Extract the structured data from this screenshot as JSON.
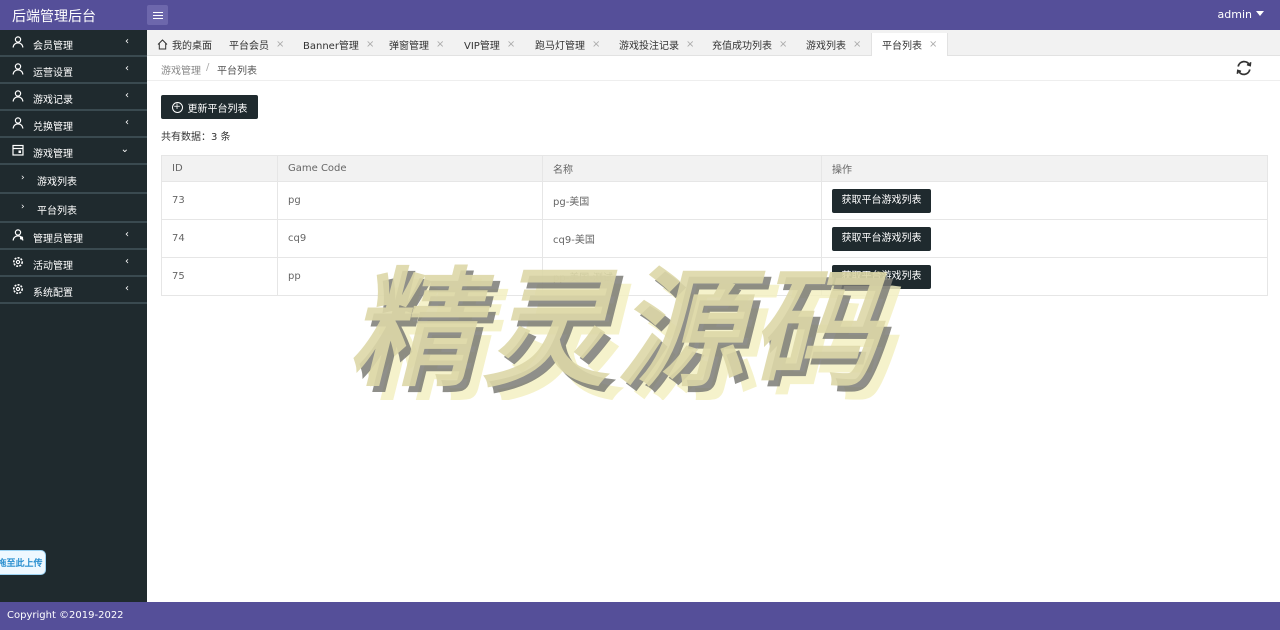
{
  "header": {
    "brand": "后端管理后台",
    "user": "admin"
  },
  "sidebar": {
    "items": [
      {
        "label": "会员管理",
        "icon": "user-icon",
        "arrow": "‹"
      },
      {
        "label": "运营设置",
        "icon": "user-icon",
        "arrow": "‹"
      },
      {
        "label": "游戏记录",
        "icon": "user-icon",
        "arrow": "‹"
      },
      {
        "label": "兑换管理",
        "icon": "user-icon",
        "arrow": "‹"
      },
      {
        "label": "游戏管理",
        "icon": "calendar-icon",
        "arrow": "⌄"
      },
      {
        "label": "管理员管理",
        "icon": "users-icon",
        "arrow": "‹"
      },
      {
        "label": "活动管理",
        "icon": "gear-icon",
        "arrow": "‹"
      },
      {
        "label": "系统配置",
        "icon": "gear-icon",
        "arrow": "‹"
      }
    ],
    "sub_items": [
      {
        "label": "游戏列表"
      },
      {
        "label": "平台列表"
      }
    ],
    "upload_tip": "拖至此上传"
  },
  "tabs": [
    {
      "label": "我的桌面"
    },
    {
      "label": "平台会员"
    },
    {
      "label": "Banner管理"
    },
    {
      "label": "弹窗管理"
    },
    {
      "label": "VIP管理"
    },
    {
      "label": "跑马灯管理"
    },
    {
      "label": "游戏投注记录"
    },
    {
      "label": "充值成功列表"
    },
    {
      "label": "游戏列表"
    },
    {
      "label": "平台列表"
    }
  ],
  "breadcrumb": {
    "parent": "游戏管理",
    "separator": "/",
    "current": "平台列表"
  },
  "toolbar": {
    "update_label": "更新平台列表",
    "total_text": "共有数据：3 条"
  },
  "table": {
    "columns": [
      "ID",
      "Game Code",
      "名称",
      "操作"
    ],
    "rows": [
      {
        "id": "73",
        "code": "pg",
        "name": "pg-美国",
        "action": "获取平台游戏列表"
      },
      {
        "id": "74",
        "code": "cq9",
        "name": "cq9-美国",
        "action": "获取平台游戏列表"
      },
      {
        "id": "75",
        "code": "pp",
        "name": "pp-美国-测试",
        "action": "获取平台游戏列表"
      }
    ]
  },
  "watermark": "精灵源码",
  "footer": {
    "copyright": "Copyright ©2019-2022"
  },
  "colors": {
    "header": "#554f99",
    "sidebar": "#1f2a2e",
    "button": "#1f2a2e"
  }
}
